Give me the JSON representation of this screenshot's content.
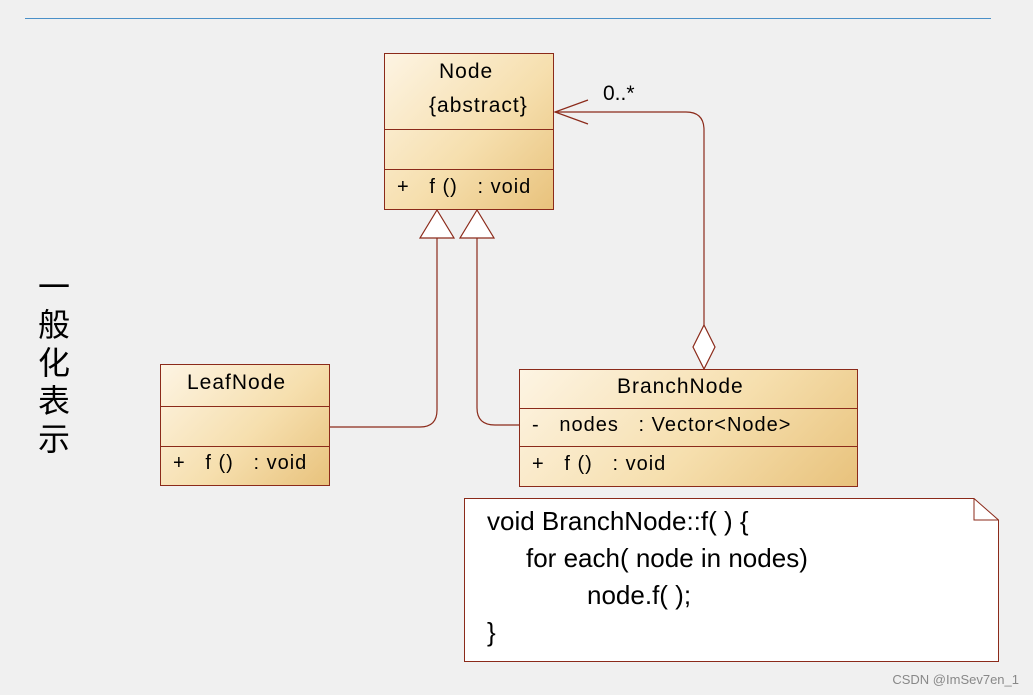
{
  "side_label": [
    "一",
    "般",
    "化",
    "表",
    "示"
  ],
  "node": {
    "name": "Node",
    "stereotype": "{abstract}",
    "operation": "+   f ()   : void"
  },
  "leaf": {
    "name": "LeafNode",
    "operation": "+   f ()   : void"
  },
  "branch": {
    "name": "BranchNode",
    "attribute": "-   nodes   : Vector<Node>",
    "operation": "+   f ()   : void"
  },
  "multiplicity": "0..*",
  "note": {
    "lines": [
      "void BranchNode::f( ) {",
      "for each( node in nodes)",
      "node.f( );",
      "}"
    ]
  },
  "watermark": "CSDN @ImSev7en_1",
  "colors": {
    "border": "#8b2a1a",
    "fill_light": "#fdf4e3",
    "fill_dark": "#e8c27c",
    "line": "#8b2a1a",
    "rule": "#4a90c8"
  }
}
